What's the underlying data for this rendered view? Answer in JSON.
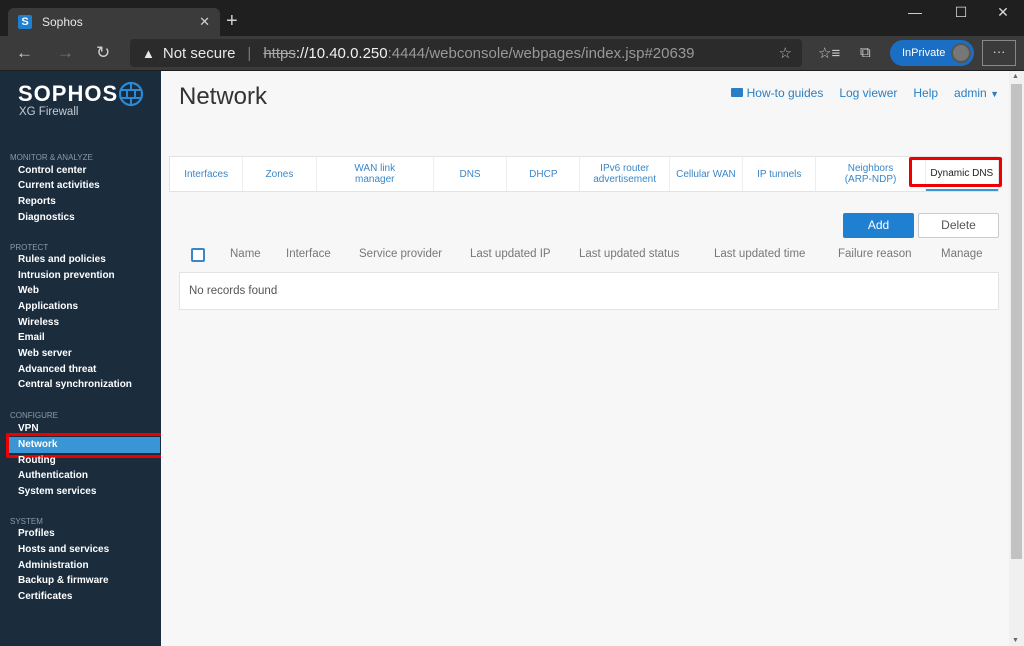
{
  "browser": {
    "tab_title": "Sophos",
    "tab_favicon": "S",
    "security_label": "Not secure",
    "url_scheme": "https",
    "url_host": "://10.40.0.250",
    "url_rest": ":4444/webconsole/webpages/index.jsp#20639",
    "inprivate_label": "InPrivate",
    "more_label": "···"
  },
  "sidebar": {
    "brand": "SOPHOS",
    "product": "XG Firewall",
    "sections": [
      {
        "title": "MONITOR & ANALYZE",
        "items": [
          "Control center",
          "Current activities",
          "Reports",
          "Diagnostics"
        ]
      },
      {
        "title": "PROTECT",
        "items": [
          "Rules and policies",
          "Intrusion prevention",
          "Web",
          "Applications",
          "Wireless",
          "Email",
          "Web server",
          "Advanced threat",
          "Central synchronization"
        ]
      },
      {
        "title": "CONFIGURE",
        "items": [
          "VPN",
          "Network",
          "Routing",
          "Authentication",
          "System services"
        ]
      },
      {
        "title": "SYSTEM",
        "items": [
          "Profiles",
          "Hosts and services",
          "Administration",
          "Backup & firmware",
          "Certificates"
        ]
      }
    ],
    "active_item": "Network"
  },
  "header": {
    "title": "Network",
    "links": {
      "howto": "How-to guides",
      "logviewer": "Log viewer",
      "help": "Help",
      "user": "admin"
    }
  },
  "tabs": [
    {
      "label": "Interfaces"
    },
    {
      "label": "Zones"
    },
    {
      "label": "WAN link manager"
    },
    {
      "label": "DNS"
    },
    {
      "label": "DHCP"
    },
    {
      "label": "IPv6 router advertisement"
    },
    {
      "label": "Cellular WAN"
    },
    {
      "label": "IP tunnels"
    },
    {
      "label": "Neighbors (ARP-NDP)"
    },
    {
      "label": "Dynamic DNS",
      "active": true
    }
  ],
  "actions": {
    "add": "Add",
    "delete": "Delete"
  },
  "table": {
    "columns": [
      "Name",
      "Interface",
      "Service provider",
      "Last updated IP",
      "Last updated status",
      "Last updated time",
      "Failure reason",
      "Manage"
    ],
    "empty_text": "No records found"
  },
  "colors": {
    "accent": "#1f7fd0",
    "sidebar_bg": "#1b2c3d",
    "highlight": "#e00000"
  }
}
